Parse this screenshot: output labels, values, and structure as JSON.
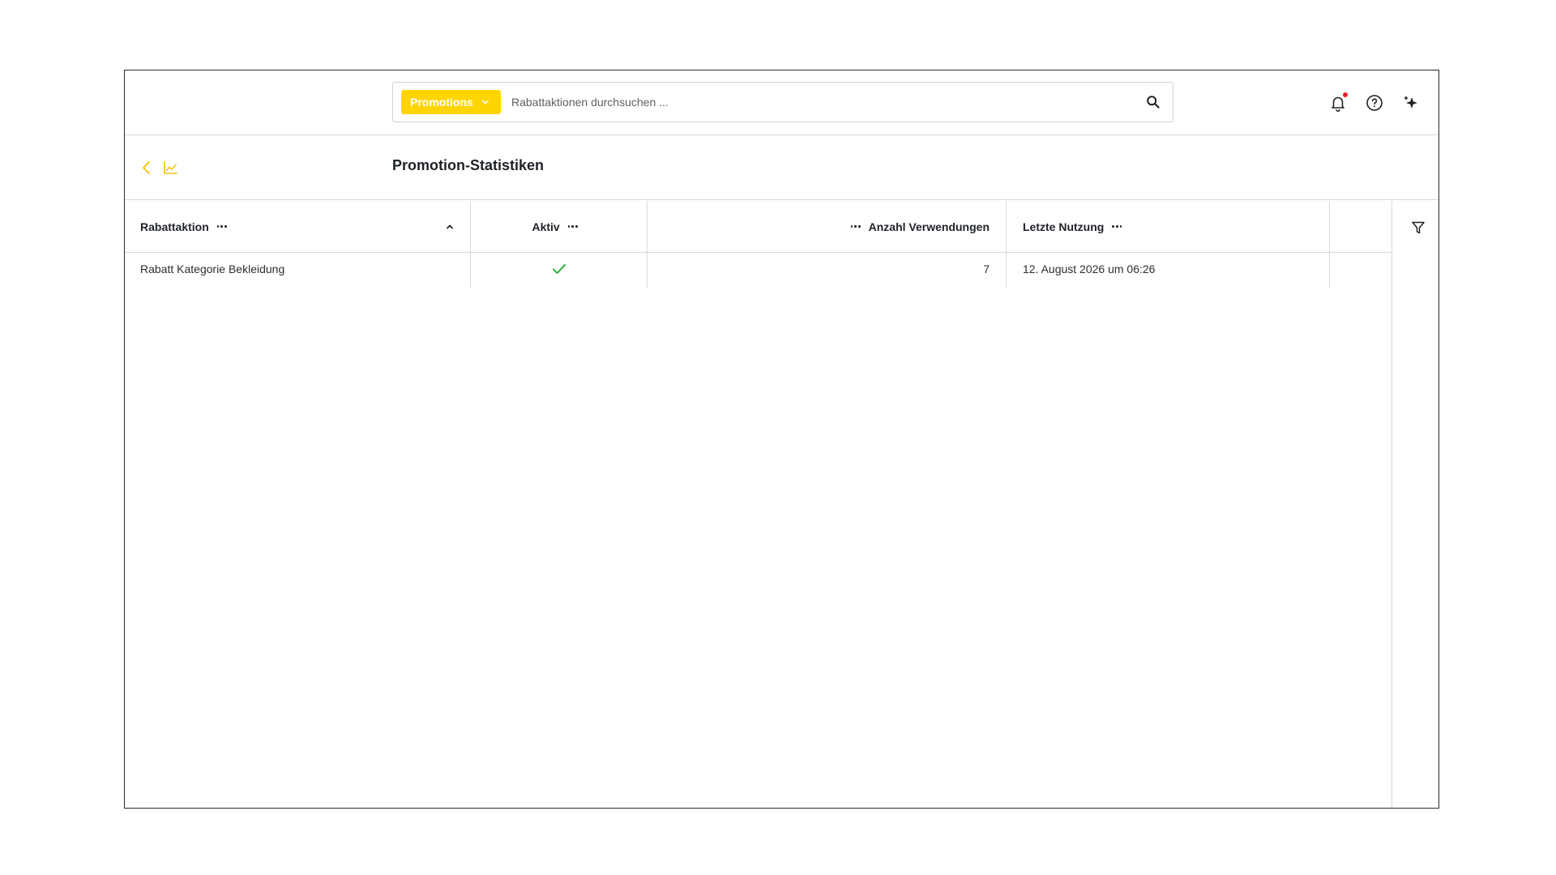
{
  "topbar": {
    "module_select": {
      "label": "Promotions"
    },
    "search": {
      "placeholder": "Rabattaktionen durchsuchen ..."
    },
    "notification_dot_color": "#e5202e"
  },
  "page": {
    "title": "Promotion-Statistiken"
  },
  "table": {
    "columns": [
      {
        "label": "Rabattaktion",
        "sort": "ascending"
      },
      {
        "label": "Aktiv"
      },
      {
        "label": "Anzahl Verwendungen"
      },
      {
        "label": "Letzte Nutzung"
      }
    ],
    "rows": [
      {
        "rabattaktion": "Rabatt Kategorie Bekleidung",
        "aktiv": true,
        "anzahl_verwendungen": "7",
        "letzte_nutzung": "12. August 2026 um 06:26"
      }
    ]
  },
  "icons": {
    "module_chevron": "chevron-down-icon",
    "search": "search-icon",
    "notifications": "bell-icon",
    "help": "help-circle-icon",
    "ai": "sparkles-icon",
    "back": "chevron-left-icon",
    "stats": "line-chart-icon",
    "active": "check-icon",
    "filter": "filter-icon",
    "sort": "chevron-up-icon"
  },
  "colors": {
    "accent": "#ffd500",
    "check": "#2fb344",
    "border": "#d6d8dc"
  }
}
